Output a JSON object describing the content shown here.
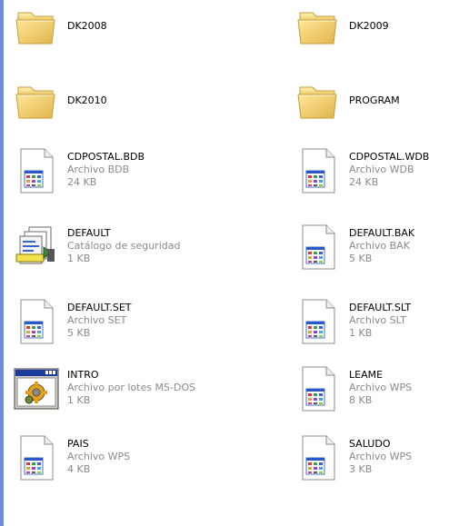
{
  "items": [
    {
      "name": "DK2008",
      "type": "",
      "size": "",
      "icon": "folder-icon"
    },
    {
      "name": "DK2009",
      "type": "",
      "size": "",
      "icon": "folder-icon"
    },
    {
      "name": "DK2010",
      "type": "",
      "size": "",
      "icon": "folder-icon"
    },
    {
      "name": "PROGRAM",
      "type": "",
      "size": "",
      "icon": "folder-icon"
    },
    {
      "name": "CDPOSTAL.BDB",
      "type": "Archivo BDB",
      "size": "24 KB",
      "icon": "file-icon"
    },
    {
      "name": "CDPOSTAL.WDB",
      "type": "Archivo WDB",
      "size": "24 KB",
      "icon": "file-icon"
    },
    {
      "name": "DEFAULT",
      "type": "Catálogo de seguridad",
      "size": "1 KB",
      "icon": "security-catalog-icon"
    },
    {
      "name": "DEFAULT.BAK",
      "type": "Archivo BAK",
      "size": "5 KB",
      "icon": "file-icon"
    },
    {
      "name": "DEFAULT.SET",
      "type": "Archivo SET",
      "size": "5 KB",
      "icon": "file-icon"
    },
    {
      "name": "DEFAULT.SLT",
      "type": "Archivo SLT",
      "size": "1 KB",
      "icon": "file-icon"
    },
    {
      "name": "INTRO",
      "type": "Archivo por lotes MS-DOS",
      "size": "1 KB",
      "icon": "batch-file-icon"
    },
    {
      "name": "LEAME",
      "type": "Archivo WPS",
      "size": "8 KB",
      "icon": "file-icon"
    },
    {
      "name": "PAIS",
      "type": "Archivo WPS",
      "size": "4 KB",
      "icon": "file-icon"
    },
    {
      "name": "SALUDO",
      "type": "Archivo WPS",
      "size": "3 KB",
      "icon": "file-icon"
    }
  ]
}
